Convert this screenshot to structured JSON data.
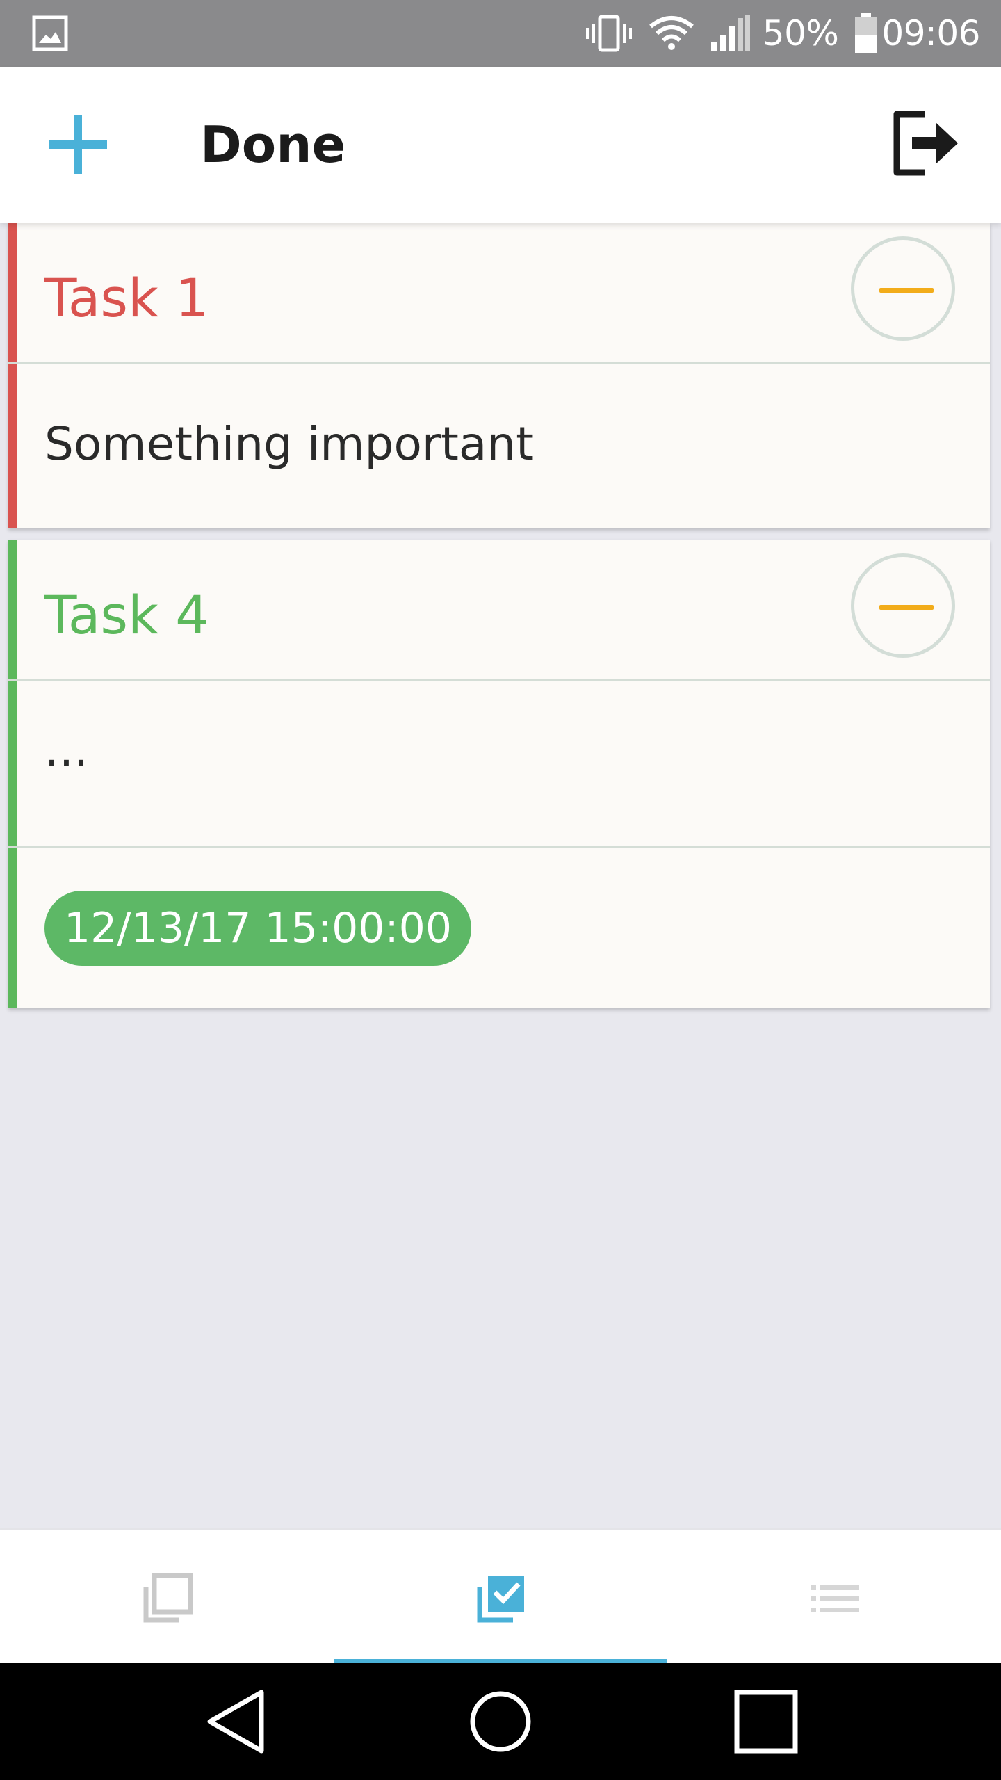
{
  "status_bar": {
    "icons": [
      "gallery-notification-icon",
      "vibrate-icon",
      "wifi-icon",
      "signal-icon",
      "battery-icon"
    ],
    "battery_percent": "50%",
    "battery_level": 0.5,
    "time": "09:06"
  },
  "header": {
    "title": "Done",
    "add_icon": "plus-icon",
    "logout_icon": "logout-icon",
    "accent_color": "#4ab1d8"
  },
  "tasks": [
    {
      "title": "Task 1",
      "description": "Something important",
      "color": "#d9534f",
      "action_icon": "minus-icon"
    },
    {
      "title": "Task 4",
      "description": "...",
      "due": "12/13/17 15:00:00",
      "color": "#5cb85c",
      "action_icon": "minus-icon"
    }
  ],
  "tabs": [
    {
      "icon": "copy-icon",
      "active": false
    },
    {
      "icon": "checkbox-stack-icon",
      "active": true
    },
    {
      "icon": "list-icon",
      "active": false
    }
  ],
  "nav_bar": {
    "icons": [
      "back-icon",
      "home-icon",
      "recents-icon"
    ]
  }
}
